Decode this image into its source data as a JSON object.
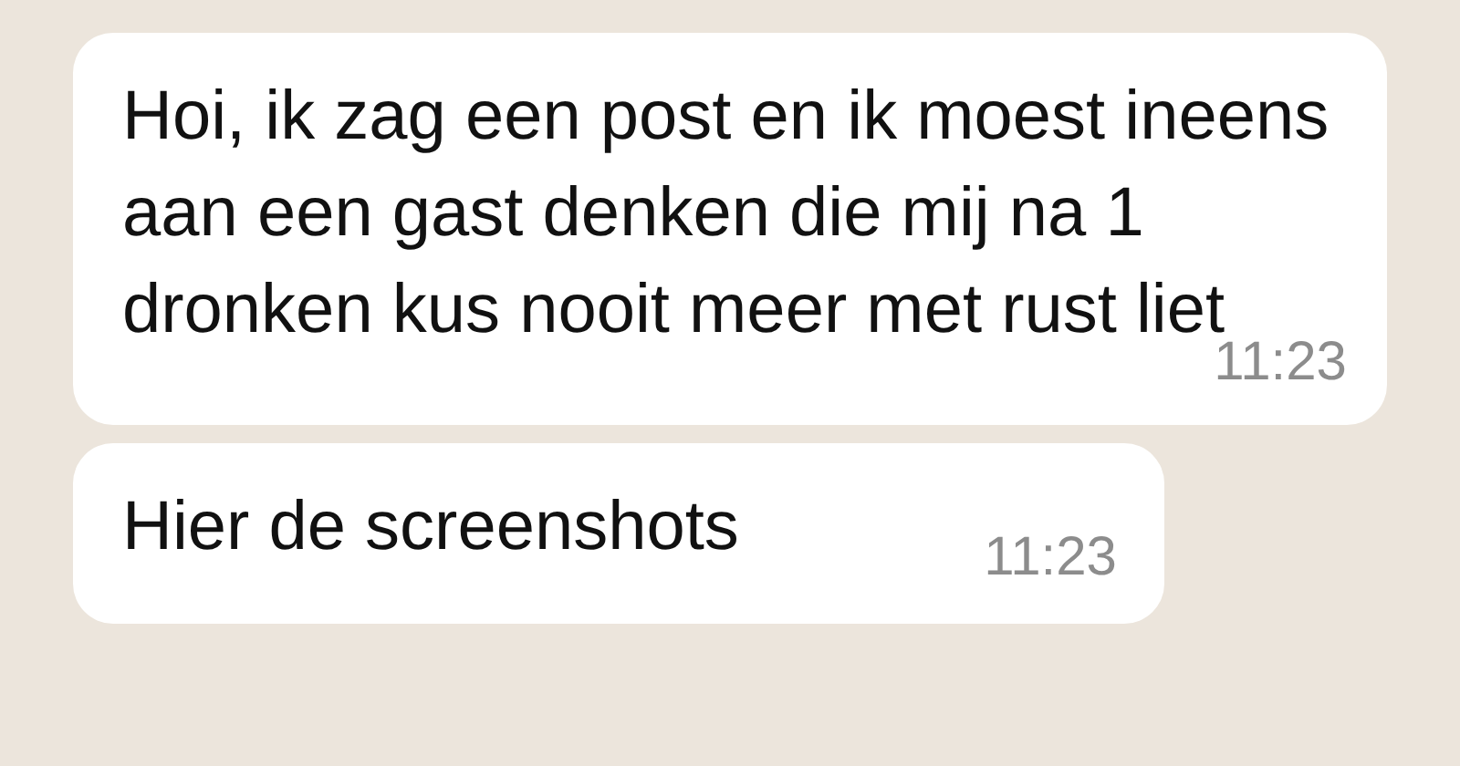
{
  "messages": [
    {
      "text": "Hoi, ik zag een post en ik moest ineens aan een gast denken die mij na 1 dronken kus nooit meer met rust liet",
      "time": "11:23"
    },
    {
      "text": "Hier de screenshots",
      "time": "11:23"
    }
  ]
}
